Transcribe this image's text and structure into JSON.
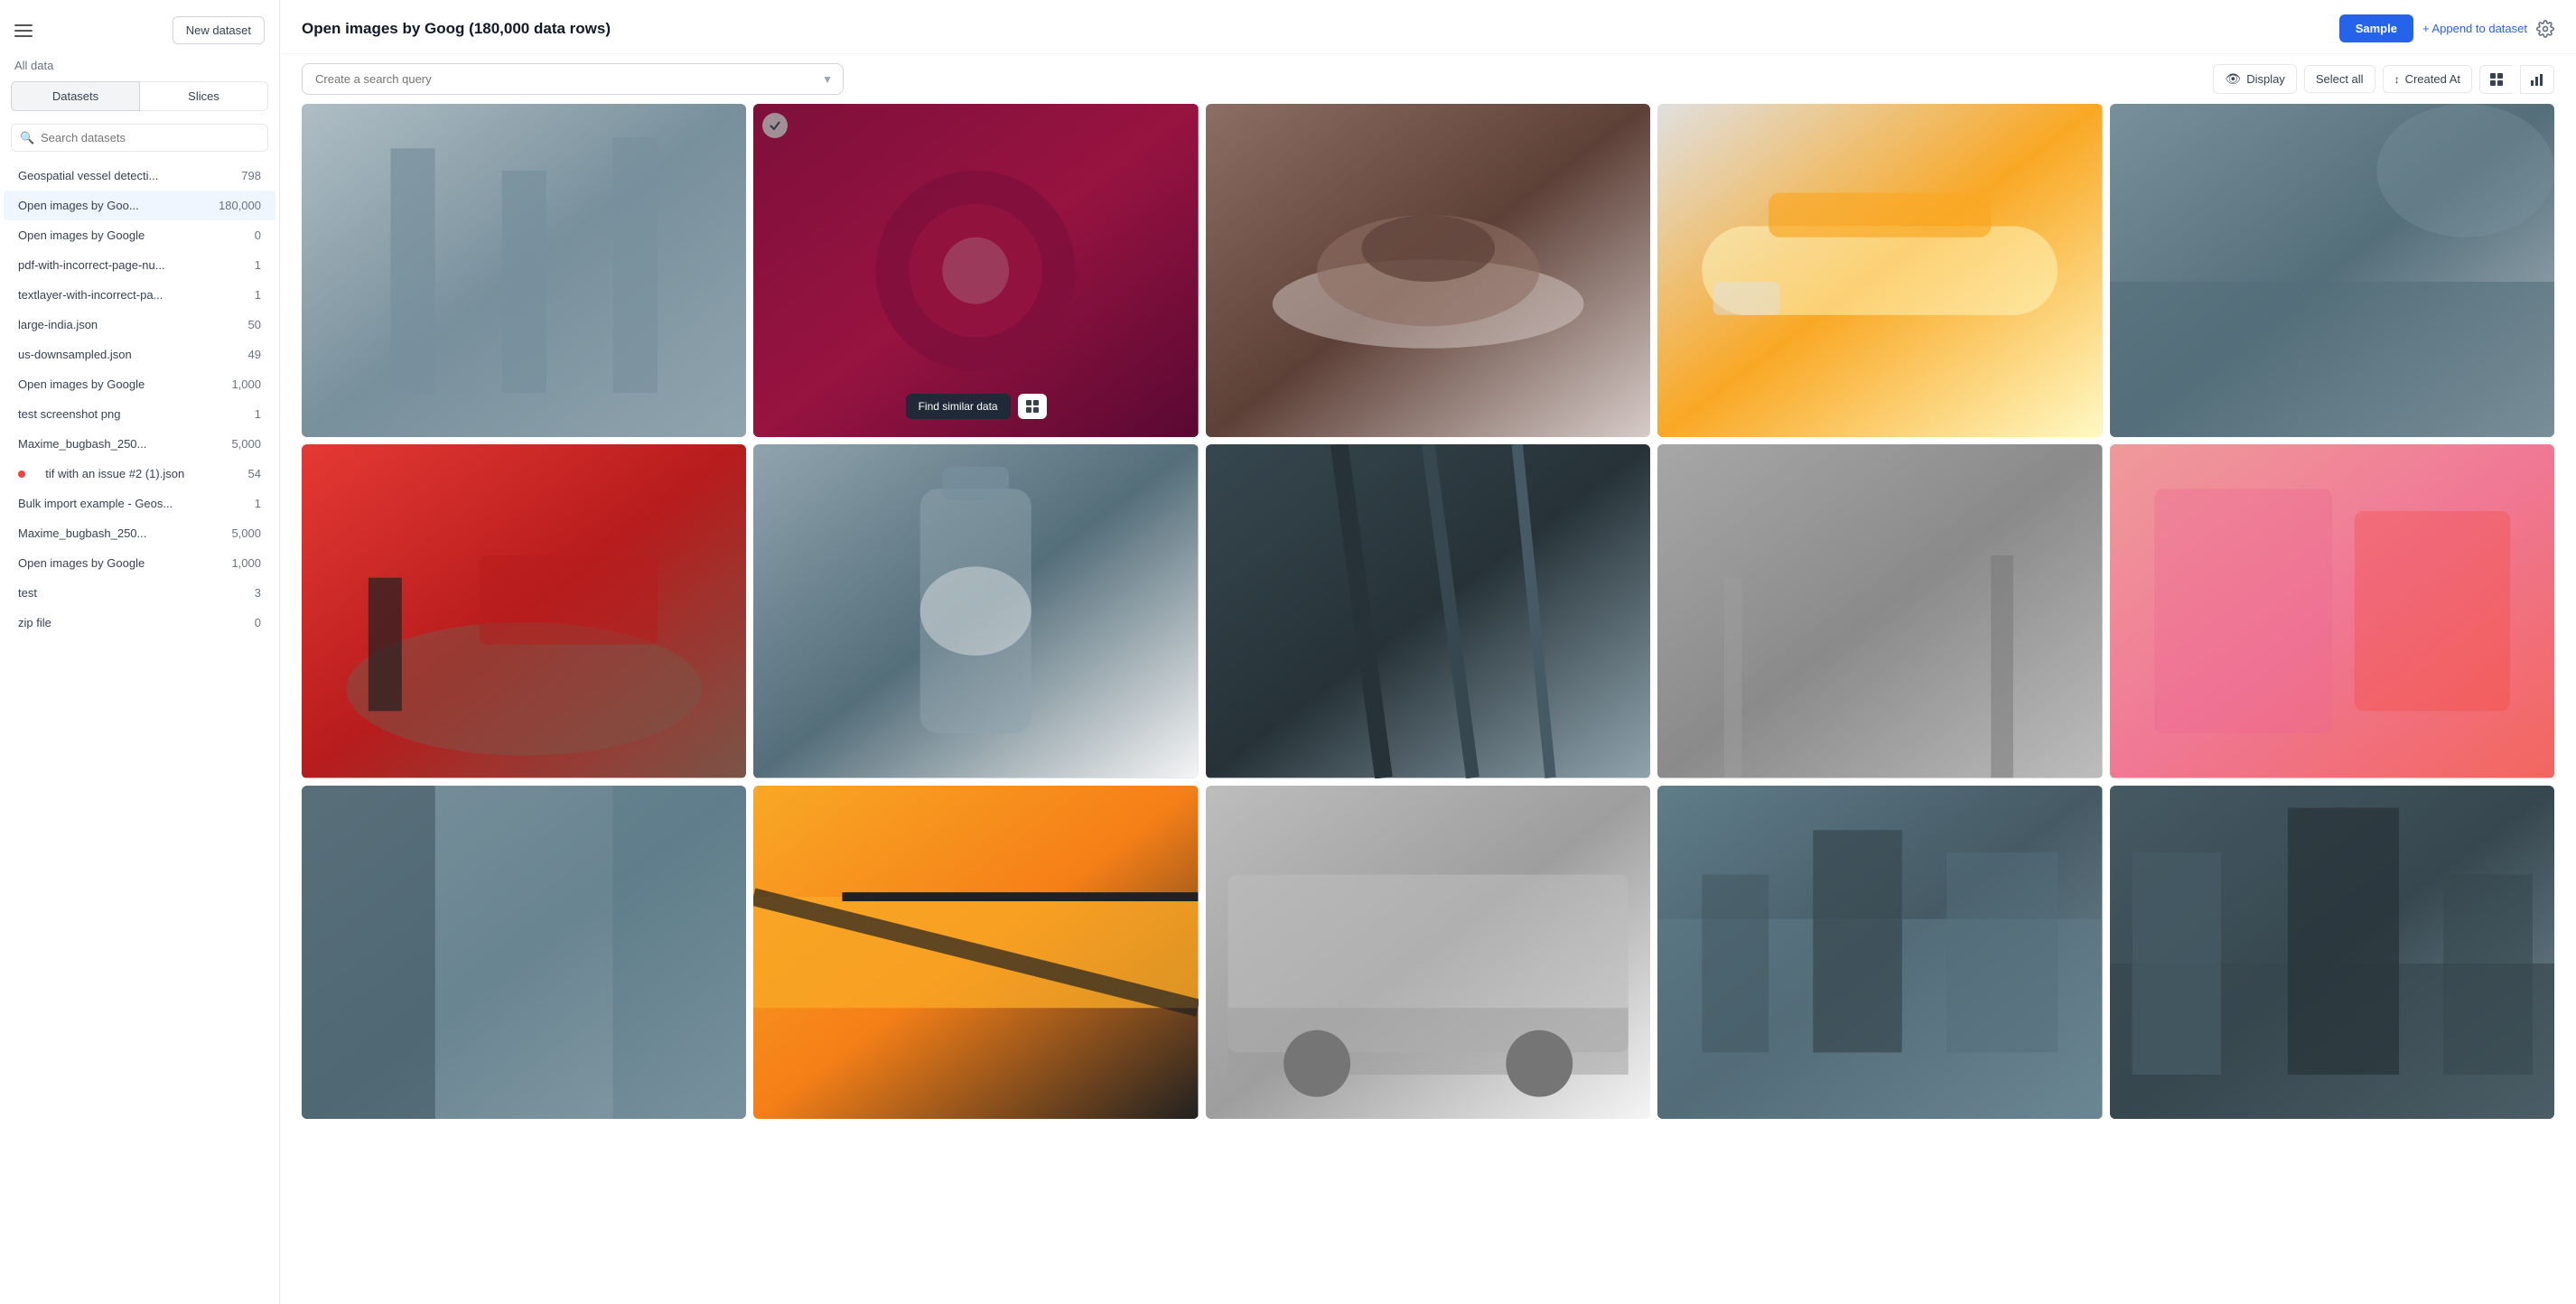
{
  "sidebar": {
    "hamburger_label": "Menu",
    "new_dataset_label": "New dataset",
    "all_data_label": "All data",
    "tabs": [
      {
        "id": "datasets",
        "label": "Datasets",
        "active": true
      },
      {
        "id": "slices",
        "label": "Slices",
        "active": false
      }
    ],
    "search_placeholder": "Search datasets",
    "datasets": [
      {
        "id": 1,
        "name": "Geospatial vessel detecti...",
        "count": "798",
        "active": false,
        "dot": false
      },
      {
        "id": 2,
        "name": "Open images by Goo...",
        "count": "180,000",
        "active": true,
        "dot": false
      },
      {
        "id": 3,
        "name": "Open images by Google",
        "count": "0",
        "active": false,
        "dot": false
      },
      {
        "id": 4,
        "name": "pdf-with-incorrect-page-nu...",
        "count": "1",
        "active": false,
        "dot": false
      },
      {
        "id": 5,
        "name": "textlayer-with-incorrect-pa...",
        "count": "1",
        "active": false,
        "dot": false
      },
      {
        "id": 6,
        "name": "large-india.json",
        "count": "50",
        "active": false,
        "dot": false
      },
      {
        "id": 7,
        "name": "us-downsampled.json",
        "count": "49",
        "active": false,
        "dot": false
      },
      {
        "id": 8,
        "name": "Open images by Google",
        "count": "1,000",
        "active": false,
        "dot": false
      },
      {
        "id": 9,
        "name": "test screenshot png",
        "count": "1",
        "active": false,
        "dot": false
      },
      {
        "id": 10,
        "name": "Maxime_bugbash_250...",
        "count": "5,000",
        "active": false,
        "dot": false
      },
      {
        "id": 11,
        "name": "tif with an issue #2 (1).json",
        "count": "54",
        "active": false,
        "dot": true
      },
      {
        "id": 12,
        "name": "Bulk import example - Geos...",
        "count": "1",
        "active": false,
        "dot": false
      },
      {
        "id": 13,
        "name": "Maxime_bugbash_250...",
        "count": "5,000",
        "active": false,
        "dot": false
      },
      {
        "id": 14,
        "name": "Open images by Google",
        "count": "1,000",
        "active": false,
        "dot": false
      },
      {
        "id": 15,
        "name": "test",
        "count": "3",
        "active": false,
        "dot": false
      },
      {
        "id": 16,
        "name": "zip file",
        "count": "0",
        "active": false,
        "dot": false
      }
    ]
  },
  "main": {
    "title": "Open images by Goog (180,000 data rows)",
    "actions": {
      "sample_label": "Sample",
      "append_label": "+ Append to dataset",
      "settings_icon": "gear"
    },
    "toolbar": {
      "search_placeholder": "Create a search query",
      "display_label": "Display",
      "select_all_label": "Select all",
      "created_at_label": "Created At",
      "grid_icon": "grid",
      "chart_icon": "chart"
    },
    "images": [
      {
        "id": 1,
        "bg": "img-bg-1",
        "hovered": false
      },
      {
        "id": 2,
        "bg": "img-bg-2",
        "hovered": true
      },
      {
        "id": 3,
        "bg": "img-bg-3",
        "hovered": false
      },
      {
        "id": 4,
        "bg": "img-bg-4",
        "hovered": false
      },
      {
        "id": 5,
        "bg": "img-bg-5",
        "hovered": false
      },
      {
        "id": 6,
        "bg": "img-bg-6",
        "hovered": false
      },
      {
        "id": 7,
        "bg": "img-bg-7",
        "hovered": false
      },
      {
        "id": 8,
        "bg": "img-bg-8",
        "hovered": false
      },
      {
        "id": 9,
        "bg": "img-bg-9",
        "hovered": false
      },
      {
        "id": 10,
        "bg": "img-bg-10",
        "hovered": false
      },
      {
        "id": 11,
        "bg": "img-bg-11",
        "hovered": false
      },
      {
        "id": 12,
        "bg": "img-bg-12",
        "hovered": false
      },
      {
        "id": 13,
        "bg": "img-bg-13",
        "hovered": false
      },
      {
        "id": 14,
        "bg": "img-bg-14",
        "hovered": false
      },
      {
        "id": 15,
        "bg": "img-bg-15",
        "hovered": false
      }
    ],
    "find_similar_label": "Find similar data",
    "display_icon_label": "👁"
  }
}
